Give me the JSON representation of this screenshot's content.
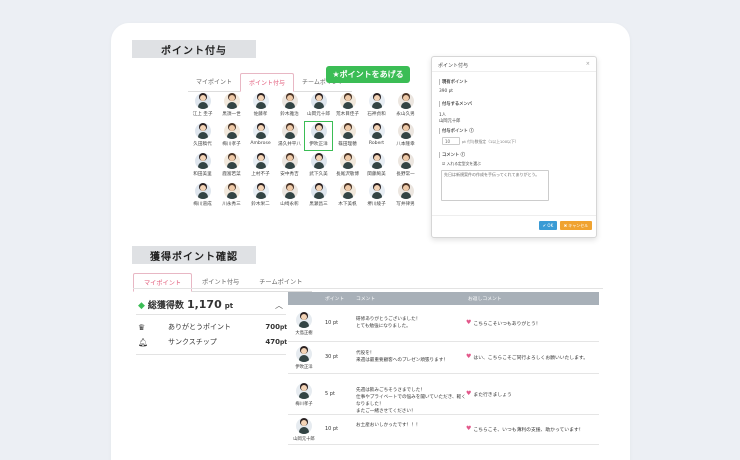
{
  "give": {
    "title": "ポイント付与",
    "tabs": [
      "マイポイント",
      "ポイント付与",
      "チームポイント"
    ],
    "button": "★ポイントをあげる",
    "people": [
      "江上 圭子",
      "黒須一世",
      "佐藤孝",
      "鈴木雅治",
      "山岡元十郎",
      "荒木目佳子",
      "石神貞和",
      "永山久男",
      "久田稿代",
      "梅川孝子",
      "Ambrose",
      "湯久井平八",
      "伊吹正洋",
      "篠田理穂",
      "Robert",
      "八本隆幸",
      "和田美里",
      "鹿富若菜",
      "上村不子",
      "安中秀吉",
      "武下久美",
      "長尾沢敬博",
      "関藤絢美",
      "長野常一",
      "梅川道成",
      "川永秀三",
      "鈴木栄二",
      "山崎永彰",
      "黒瀬昌三",
      "木下美帆",
      "堺川綾子",
      "写井律男"
    ],
    "selected_index": 12
  },
  "modal": {
    "title": "ポイント付与",
    "close": "×",
    "have_label": "現有ポイント",
    "have_value": "390 pt",
    "target_label": "付与するメンバ",
    "target_count": "1人",
    "target_name": "山岡元十郎",
    "points_label": "付与ポイント ⓘ",
    "points_value": "10",
    "points_hint": "pt 付与数指定（1以上100以下）",
    "comment_label": "コメント ⓘ",
    "comment_check": "☑ 入れる定型文を選ぶ",
    "comment_text": "先日は新規案件の作成を手伝ってくれてありがとう。",
    "ok": "✔ OK",
    "cancel": "✖ キャンセル"
  },
  "earned": {
    "title": "獲得ポイント確認",
    "tabs": [
      "マイポイント",
      "ポイント付与",
      "チームポイント"
    ],
    "total_label": "総獲得数",
    "total_value": "1,170",
    "total_unit": "pt",
    "rows": [
      {
        "label": "ありがとうポイント",
        "value": "700",
        "unit": "pt"
      },
      {
        "label": "サンクスチップ",
        "value": "470",
        "unit": "pt"
      }
    ],
    "columns": [
      "ポイント",
      "コメント",
      "お返しコメント"
    ],
    "entries": [
      {
        "name": "大島正樹",
        "points": "10 pt",
        "comment": "研修ありがとうございました！\nとても勉強になりました。",
        "reply": "こちらこそいつもありがとう！"
      },
      {
        "name": "伊吹正洋",
        "points": "30 pt",
        "comment": "代役を！\n来週は最重要顧客へのプレゼン頑張ります！",
        "reply": "はい、こちらこそご同行よろしくお願いいたします。"
      },
      {
        "name": "梅川孝子",
        "points": "5 pt",
        "comment": "先週は飲みごちそうさまでした！\n仕事やプライベートでの悩みを聞いていただき、軽くなりました！\nまたご一緒させてください！",
        "reply": "また行きましょう"
      },
      {
        "name": "山岡元十郎",
        "points": "10 pt",
        "comment": "お土産おいしかったです！！！",
        "reply": "こちらこそ、いつも薄利の支援、助かっています！"
      }
    ]
  },
  "colors": {
    "accent_green": "#3bbd55",
    "accent_pink": "#e2578a",
    "table_head": "#a8b0b8"
  }
}
